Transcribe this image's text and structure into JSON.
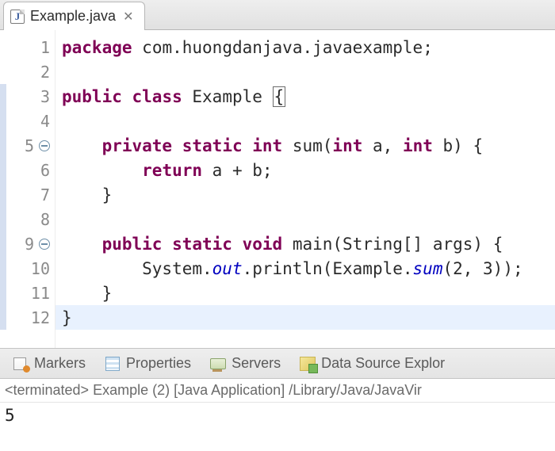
{
  "tab": {
    "icon_letter": "J",
    "filename": "Example.java"
  },
  "gutter": {
    "highlight_start": 3,
    "highlight_end": 12,
    "fold_lines": [
      5,
      9
    ]
  },
  "code": [
    {
      "n": 1,
      "tokens": [
        [
          "kw",
          "package"
        ],
        [
          "pl",
          " "
        ],
        [
          "pkg",
          "com.huongdanjava.javaexample"
        ],
        [
          "pl",
          ";"
        ]
      ]
    },
    {
      "n": 2,
      "tokens": []
    },
    {
      "n": 3,
      "tokens": [
        [
          "kw",
          "public"
        ],
        [
          "pl",
          " "
        ],
        [
          "kw",
          "class"
        ],
        [
          "pl",
          " "
        ],
        [
          "pl",
          "Example "
        ],
        [
          "cursor",
          "{"
        ]
      ]
    },
    {
      "n": 4,
      "tokens": []
    },
    {
      "n": 5,
      "tokens": [
        [
          "pl",
          "    "
        ],
        [
          "kw",
          "private"
        ],
        [
          "pl",
          " "
        ],
        [
          "kw",
          "static"
        ],
        [
          "pl",
          " "
        ],
        [
          "kw",
          "int"
        ],
        [
          "pl",
          " sum("
        ],
        [
          "kw",
          "int"
        ],
        [
          "pl",
          " a, "
        ],
        [
          "kw",
          "int"
        ],
        [
          "pl",
          " b) {"
        ]
      ]
    },
    {
      "n": 6,
      "tokens": [
        [
          "pl",
          "        "
        ],
        [
          "kw",
          "return"
        ],
        [
          "pl",
          " a + b;"
        ]
      ]
    },
    {
      "n": 7,
      "tokens": [
        [
          "pl",
          "    }"
        ]
      ]
    },
    {
      "n": 8,
      "tokens": []
    },
    {
      "n": 9,
      "tokens": [
        [
          "pl",
          "    "
        ],
        [
          "kw",
          "public"
        ],
        [
          "pl",
          " "
        ],
        [
          "kw",
          "static"
        ],
        [
          "pl",
          " "
        ],
        [
          "kw",
          "void"
        ],
        [
          "pl",
          " main(String[] args) {"
        ]
      ]
    },
    {
      "n": 10,
      "tokens": [
        [
          "pl",
          "        System."
        ],
        [
          "sf",
          "out"
        ],
        [
          "pl",
          ".println(Example."
        ],
        [
          "sf",
          "sum"
        ],
        [
          "pl",
          "(2, 3));"
        ]
      ]
    },
    {
      "n": 11,
      "tokens": [
        [
          "pl",
          "    }"
        ]
      ]
    },
    {
      "n": 12,
      "tokens": [
        [
          "pl",
          "}"
        ]
      ],
      "current": true
    }
  ],
  "views": [
    {
      "icon": "ic-markers",
      "label": "Markers",
      "name": "view-markers"
    },
    {
      "icon": "ic-props",
      "label": "Properties",
      "name": "view-properties"
    },
    {
      "icon": "ic-servers",
      "label": "Servers",
      "name": "view-servers"
    },
    {
      "icon": "ic-ds",
      "label": "Data Source Explor",
      "name": "view-data-source-explorer"
    }
  ],
  "console": {
    "header": "<terminated> Example (2) [Java Application] /Library/Java/JavaVir",
    "output": "5"
  }
}
